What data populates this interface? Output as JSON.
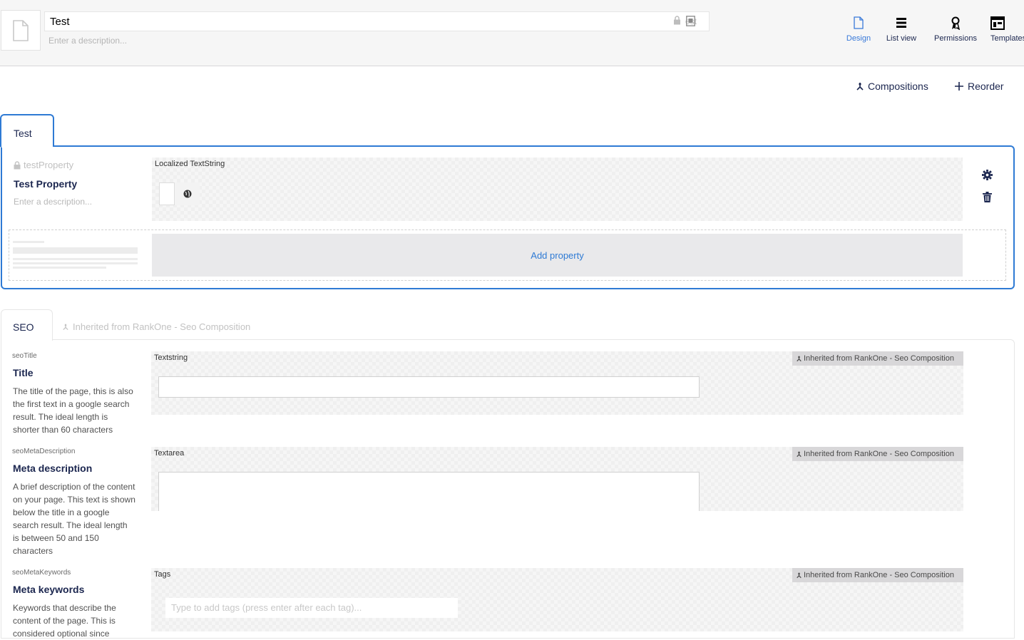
{
  "header": {
    "name_value": "Test",
    "alias_text": "est",
    "description_placeholder": "Enter a description..."
  },
  "app_nav": [
    {
      "label": "Design",
      "icon": "document-icon",
      "active": true
    },
    {
      "label": "List view",
      "icon": "list-icon"
    },
    {
      "label": "Permissions",
      "icon": "ribbon-icon"
    },
    {
      "label": "Templates",
      "icon": "layout-icon"
    }
  ],
  "toolbar": {
    "compositions_label": "Compositions",
    "reorder_label": "Reorder"
  },
  "group_test": {
    "tab_label": "Test",
    "property": {
      "alias": "testProperty",
      "label": "Test Property",
      "description_placeholder": "Enter a description...",
      "editor": "Localized TextString"
    },
    "add_property_label": "Add property"
  },
  "group_seo": {
    "tab_label": "SEO",
    "inherited_label": "Inherited from RankOne - Seo Composition",
    "properties": [
      {
        "alias": "seoTitle",
        "label": "Title",
        "description": "The title of the page, this is also the first text in a google search result. The ideal length is shorter than 60 characters",
        "editor": "Textstring",
        "badge": "Inherited from RankOne - Seo Composition"
      },
      {
        "alias": "seoMetaDescription",
        "label": "Meta description",
        "description": "A brief description of the content on your page. This text is shown below the title in a google search result. The ideal length is between 50 and 150 characters",
        "editor": "Textarea",
        "badge": "Inherited from RankOne - Seo Composition"
      },
      {
        "alias": "seoMetaKeywords",
        "label": "Meta keywords",
        "description": "Keywords that describe the content of the page. This is considered optional since",
        "editor": "Tags",
        "badge": "Inherited from RankOne - Seo Composition",
        "tags_placeholder": "Type to add tags (press enter after each tag)..."
      }
    ]
  },
  "colors": {
    "accent": "#2e7ad4",
    "text": "#1b264f",
    "badge_bg": "#d8d7d9"
  }
}
